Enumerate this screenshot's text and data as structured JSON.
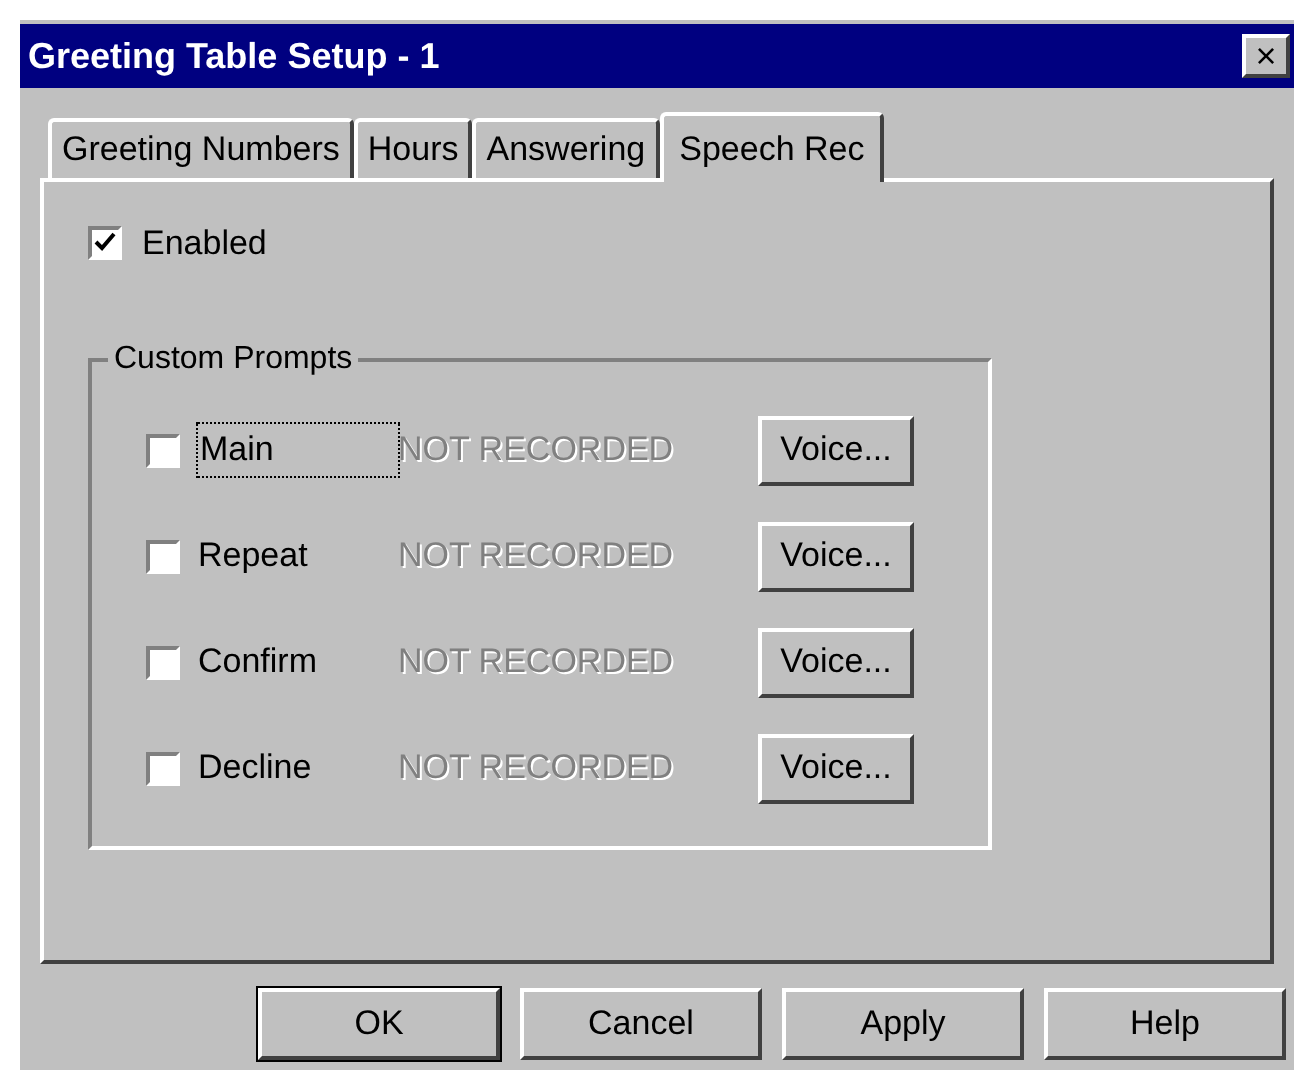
{
  "window": {
    "title": "Greeting Table Setup - 1",
    "close": "×"
  },
  "tabs": [
    {
      "label": "Greeting Numbers",
      "selected": false
    },
    {
      "label": "Hours",
      "selected": false
    },
    {
      "label": "Answering",
      "selected": false
    },
    {
      "label": "Speech Rec",
      "selected": true
    }
  ],
  "enabled": {
    "label": "Enabled",
    "checked": true
  },
  "custom_prompts": {
    "title": "Custom Prompts",
    "rows": [
      {
        "label": "Main",
        "checked": false,
        "focused": true,
        "status": "NOT RECORDED",
        "status_disabled": true,
        "button": "Voice..."
      },
      {
        "label": "Repeat",
        "checked": false,
        "focused": false,
        "status": "NOT RECORDED",
        "status_disabled": true,
        "button": "Voice..."
      },
      {
        "label": "Confirm",
        "checked": false,
        "focused": false,
        "status": "NOT RECORDED",
        "status_disabled": true,
        "button": "Voice..."
      },
      {
        "label": "Decline",
        "checked": false,
        "focused": false,
        "status": "NOT RECORDED",
        "status_disabled": true,
        "button": "Voice..."
      }
    ]
  },
  "buttons": [
    {
      "label": "OK",
      "default": true
    },
    {
      "label": "Cancel",
      "default": false
    },
    {
      "label": "Apply",
      "default": false
    },
    {
      "label": "Help",
      "default": false
    }
  ]
}
